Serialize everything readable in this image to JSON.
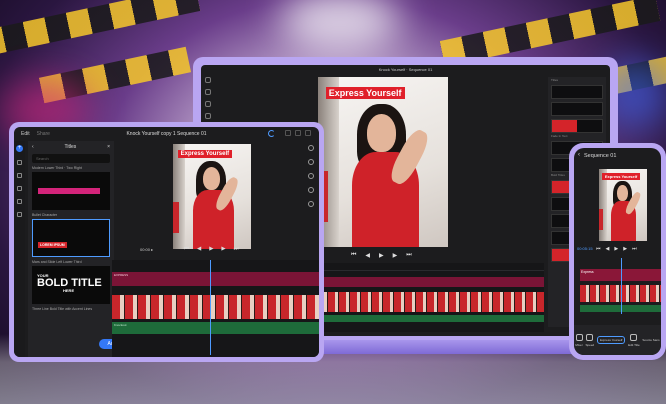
{
  "colors": {
    "accent": "#3478f6",
    "brand": "#b9a6f2",
    "title_red": "#e0202a",
    "clip_red": "#c8262b",
    "audio_green": "#1e6b3a",
    "title_track": "#7a1436"
  },
  "overlay_text": "Express Yourself",
  "laptop": {
    "title": "Knock Yourself · Sequence 01",
    "panel_labels": [
      "Titles",
      "Fade In Text",
      "Bold Titles"
    ],
    "transport": [
      "⏮",
      "◀",
      "▶",
      "▶",
      "⏭"
    ]
  },
  "tablet": {
    "tabs": {
      "edit": "Edit",
      "share": "Share"
    },
    "title": "Knock Yourself copy 1 Sequence 01",
    "panel_title": "Titles",
    "back_icon": "‹",
    "close_icon": "×",
    "search_placeholder": "Search",
    "captions": [
      "Modern Lower Third · Two Right",
      "Bullet Character",
      "Mars and Slide Left Lower Third",
      "Three Line Bold Title with Accent Lines"
    ],
    "lorem_text": "LOREM IPSUM",
    "bold_title": {
      "line1": "YOUR",
      "line2": "BOLD TITLE",
      "line3": "HERE"
    },
    "add_label": "Add",
    "timecode": "00:00 ▸",
    "transport": [
      "⏮",
      "◀",
      "▶",
      "▶",
      "⏭"
    ],
    "title_track_label": "EXPRESS",
    "audio_track_label": "Knockout"
  },
  "phone": {
    "back": "‹",
    "title": "Sequence 01",
    "timecode": "00:05:15",
    "transport": [
      "⏮",
      "◀",
      "▶",
      "▶",
      "⏭"
    ],
    "title_track_label": "Express",
    "bottom_buttons": [
      "Mixer",
      "Speed",
      "Express Yourself",
      "Edit Title",
      "Source Sans"
    ]
  }
}
